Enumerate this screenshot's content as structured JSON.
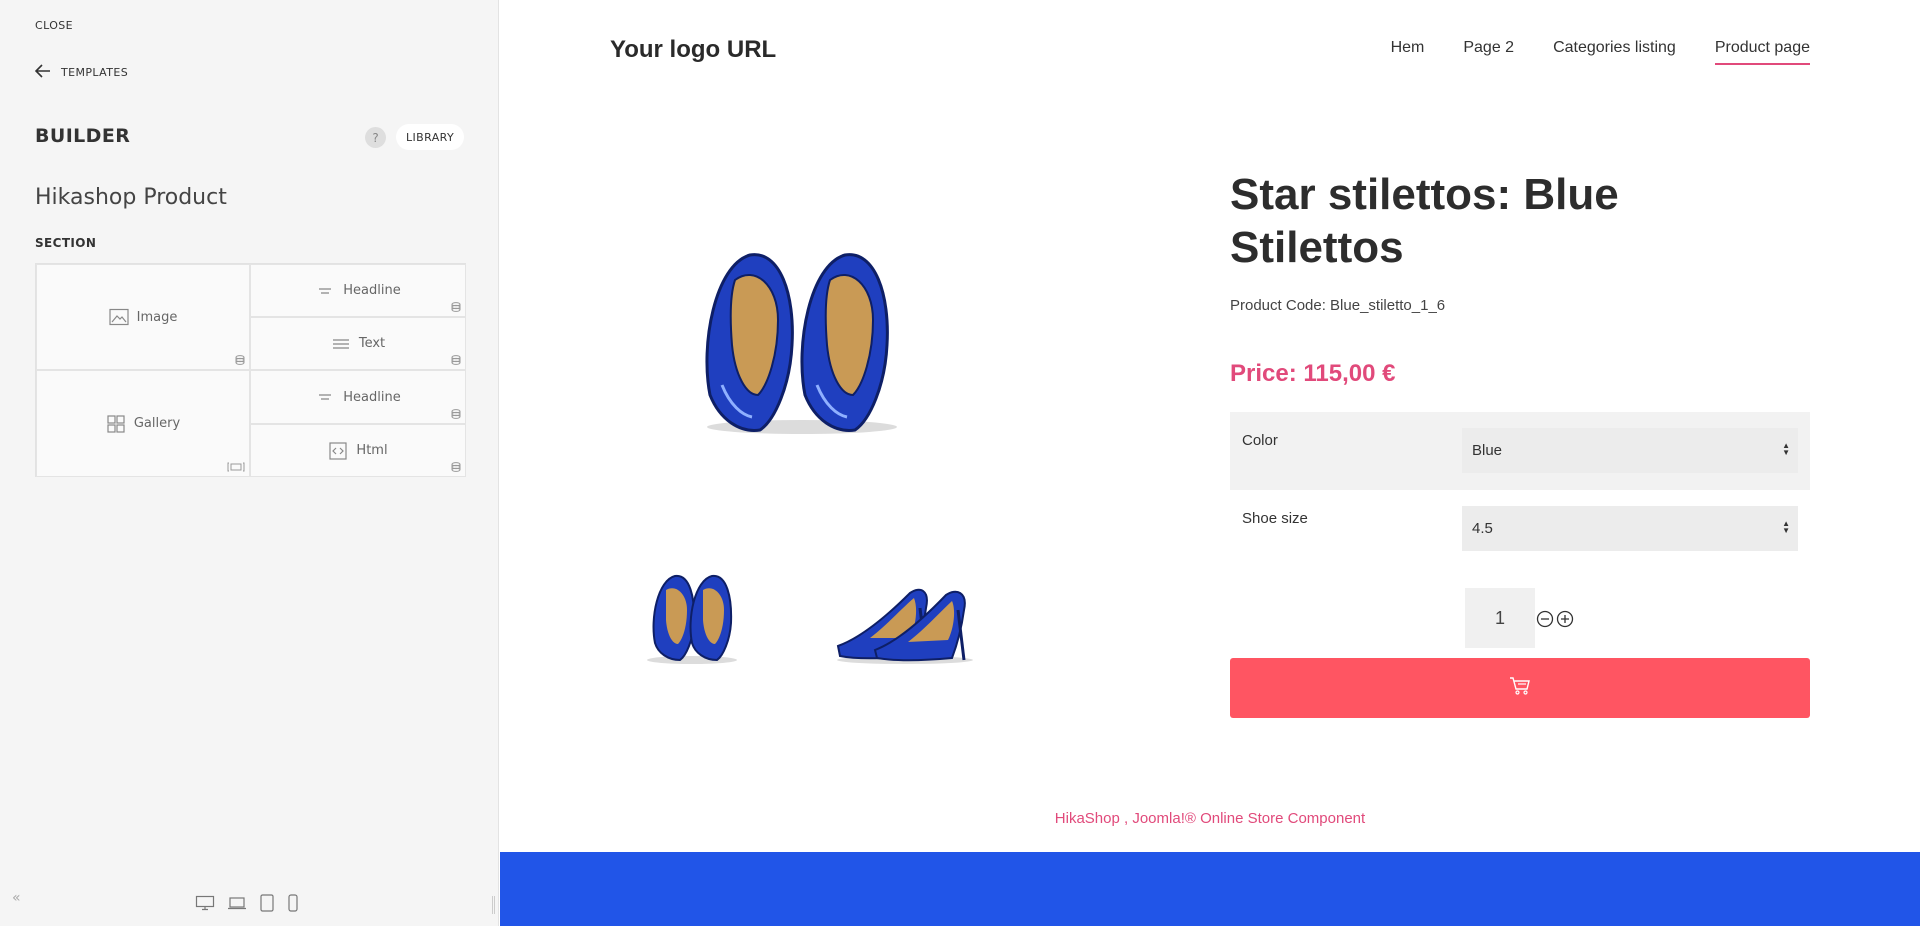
{
  "sidebar": {
    "close_label": "CLOSE",
    "templates_label": "TEMPLATES",
    "builder_title": "BUILDER",
    "help_label": "?",
    "library_label": "LIBRARY",
    "layout_name": "Hikashop Product",
    "section_label": "SECTION",
    "collapse_label": "«",
    "cells": [
      {
        "label": "Image",
        "icon": "image-icon"
      },
      {
        "label": "Headline",
        "icon": "headline-icon"
      },
      {
        "label": "Text",
        "icon": "text-icon"
      },
      {
        "label": "Gallery",
        "icon": "gallery-icon"
      },
      {
        "label": "Headline",
        "icon": "headline-icon"
      },
      {
        "label": "Html",
        "icon": "html-icon"
      }
    ],
    "devices": [
      "desktop-icon",
      "laptop-icon",
      "tablet-icon",
      "phone-icon"
    ]
  },
  "site": {
    "logo": "Your logo URL",
    "nav": [
      {
        "label": "Hem",
        "active": false
      },
      {
        "label": "Page 2",
        "active": false
      },
      {
        "label": "Categories listing",
        "active": false
      },
      {
        "label": "Product page",
        "active": true
      }
    ],
    "product": {
      "title": "Star stilettos: Blue Stilettos",
      "code": "Product Code: Blue_stiletto_1_6",
      "price": "Price: 115,00 €",
      "options": [
        {
          "label": "Color",
          "value": "Blue"
        },
        {
          "label": "Shoe size",
          "value": "4.5"
        }
      ],
      "quantity": "1"
    },
    "footer_link": "HikaShop , Joomla!® Online Store Component",
    "colors": {
      "accent": "#e14a7b",
      "cart_button": "#ff5562",
      "footer_bar": "#2155e8",
      "shoe_blue": "#1f3fbf"
    }
  }
}
